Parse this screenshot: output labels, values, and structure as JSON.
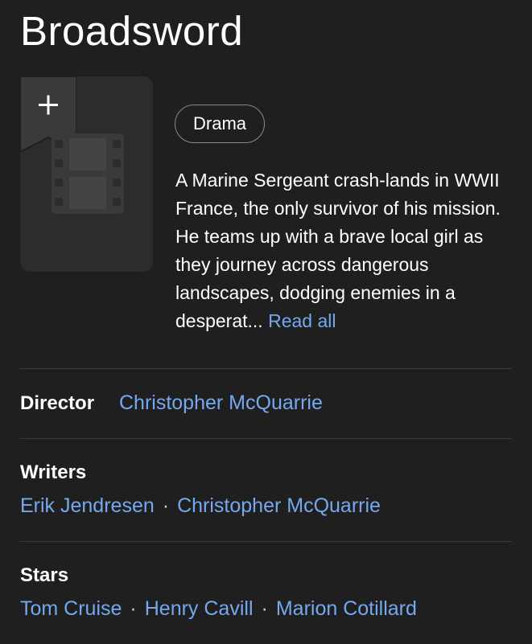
{
  "title": "Broadsword",
  "watchlist": {
    "icon": "plus-icon"
  },
  "poster": {
    "icon": "film-icon"
  },
  "genre": "Drama",
  "plot": {
    "text": "A Marine Sergeant crash-lands in WWII France, the only survivor of his mission. He teams up with a brave local girl as they journey across dangerous landscapes, dodging enemies in a desperat...",
    "read_more": "Read all"
  },
  "director": {
    "label": "Director",
    "names": [
      "Christopher McQuarrie"
    ]
  },
  "writers": {
    "label": "Writers",
    "names": [
      "Erik Jendresen",
      "Christopher McQuarrie"
    ]
  },
  "stars": {
    "label": "Stars",
    "names": [
      "Tom Cruise",
      "Henry Cavill",
      "Marion Cotillard"
    ]
  },
  "separator": "·",
  "colors": {
    "background": "#1f1f1f",
    "link": "#74a9f0",
    "text": "#ffffff"
  }
}
